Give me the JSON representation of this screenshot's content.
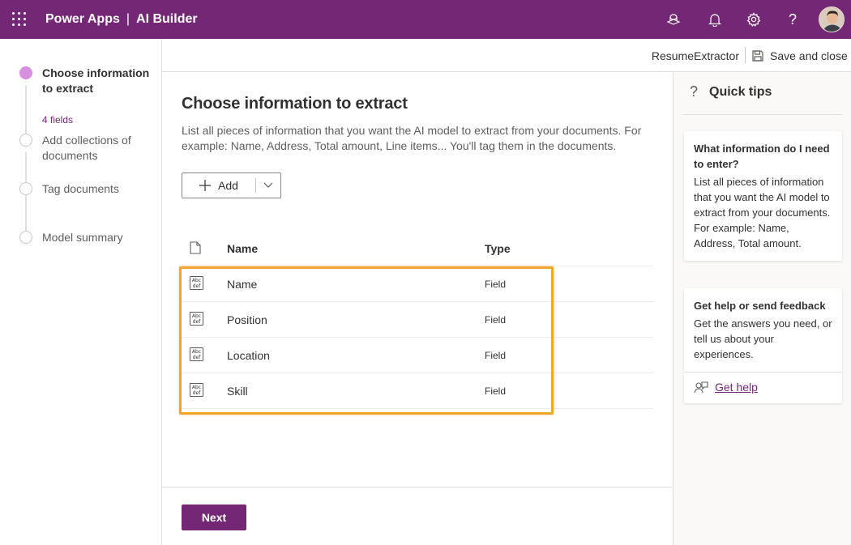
{
  "colors": {
    "brand": "#742774",
    "active_step": "#d78fe0",
    "highlight": "#f1a52a"
  },
  "topbar": {
    "app_name": "Power Apps",
    "separator": "|",
    "section": "AI Builder",
    "icons": [
      "waffle-icon",
      "environment-icon",
      "bell-icon",
      "gear-icon",
      "help-icon",
      "avatar"
    ]
  },
  "steps": [
    {
      "label": "Choose information to extract",
      "sub": "4 fields",
      "active": true
    },
    {
      "label": "Add collections of documents",
      "active": false
    },
    {
      "label": "Tag documents",
      "active": false
    },
    {
      "label": "Model summary",
      "active": false
    }
  ],
  "header": {
    "model_name": "ResumeExtractor",
    "save_label": "Save and close"
  },
  "main": {
    "title": "Choose information to extract",
    "description": "List all pieces of information that you want the AI model to extract from your documents. For example: Name, Address, Total amount, Line items... You'll tag them in the documents.",
    "add_label": "Add",
    "columns": {
      "name": "Name",
      "type": "Type"
    },
    "rows": [
      {
        "name": "Name",
        "type": "Field"
      },
      {
        "name": "Position",
        "type": "Field"
      },
      {
        "name": "Location",
        "type": "Field"
      },
      {
        "name": "Skill",
        "type": "Field"
      }
    ],
    "next_label": "Next"
  },
  "tips": {
    "title": "Quick tips",
    "q_glyph": "?",
    "card1": {
      "title": "What information do I need to enter?",
      "body": "List all pieces of information that you want the AI model to extract from your documents. For example: Name, Address, Total amount."
    },
    "card2": {
      "title": "Get help or send feedback",
      "body": "Get the answers you need, or tell us about your experiences.",
      "link": "Get help"
    }
  },
  "field_icon_text": {
    "top": "Abc",
    "bottom": "def"
  }
}
